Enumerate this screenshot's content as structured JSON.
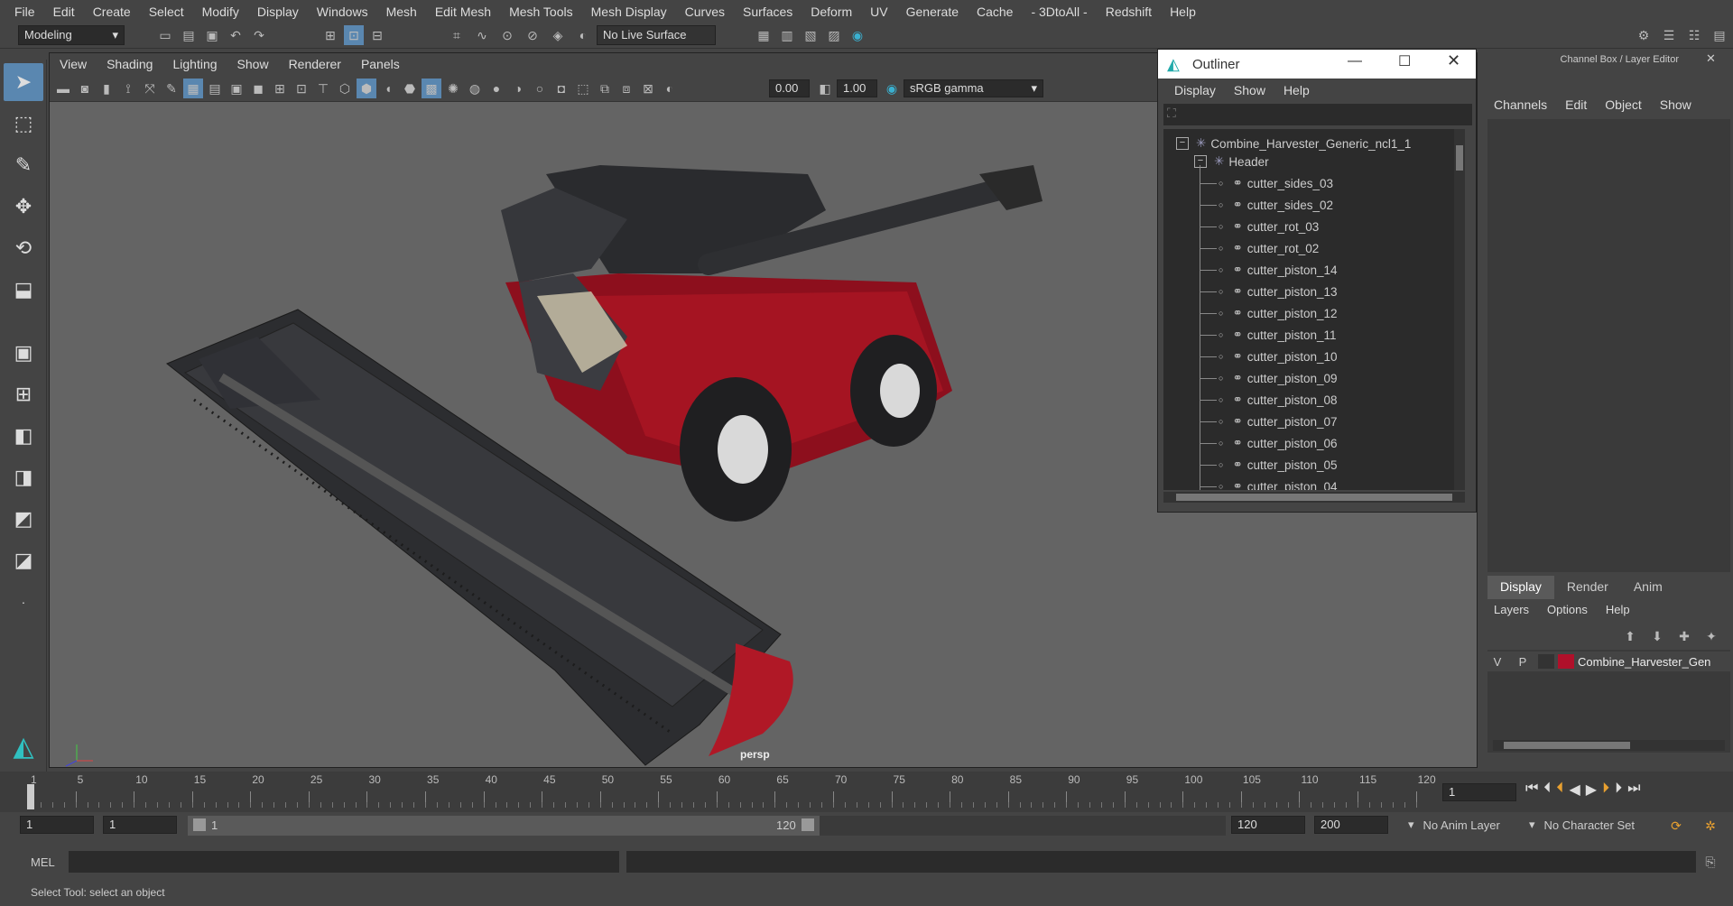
{
  "menubar": [
    "File",
    "Edit",
    "Create",
    "Select",
    "Modify",
    "Display",
    "Windows",
    "Mesh",
    "Edit Mesh",
    "Mesh Tools",
    "Mesh Display",
    "Curves",
    "Surfaces",
    "Deform",
    "UV",
    "Generate",
    "Cache",
    "- 3DtoAll -",
    "Redshift",
    "Help"
  ],
  "shelf": {
    "mode": "Modeling",
    "live_surface": "No Live Surface"
  },
  "viewport": {
    "menu": [
      "View",
      "Shading",
      "Lighting",
      "Show",
      "Renderer",
      "Panels"
    ],
    "exposure": "0.00",
    "gamma": "1.00",
    "color_space": "sRGB gamma",
    "camera_label": "persp"
  },
  "outliner": {
    "title": "Outliner",
    "menu": [
      "Display",
      "Show",
      "Help"
    ],
    "root": "Combine_Harvester_Generic_ncl1_1",
    "group": "Header",
    "items": [
      "cutter_sides_03",
      "cutter_sides_02",
      "cutter_rot_03",
      "cutter_rot_02",
      "cutter_piston_14",
      "cutter_piston_13",
      "cutter_piston_12",
      "cutter_piston_11",
      "cutter_piston_10",
      "cutter_piston_09",
      "cutter_piston_08",
      "cutter_piston_07",
      "cutter_piston_06",
      "cutter_piston_05",
      "cutter_piston_04"
    ]
  },
  "channel_box": {
    "title": "Channel Box / Layer Editor",
    "menu": [
      "Channels",
      "Edit",
      "Object",
      "Show"
    ],
    "tabs": [
      "Display",
      "Render",
      "Anim"
    ],
    "layer_menu": [
      "Layers",
      "Options",
      "Help"
    ],
    "layer": {
      "v": "V",
      "p": "P",
      "name": "Combine_Harvester_Gen",
      "color": "#b0102a"
    }
  },
  "timeline": {
    "ticks": [
      "1",
      "5",
      "10",
      "15",
      "20",
      "25",
      "30",
      "35",
      "40",
      "45",
      "50",
      "55",
      "60",
      "65",
      "70",
      "75",
      "80",
      "85",
      "90",
      "95",
      "100",
      "105",
      "110",
      "115",
      "120"
    ],
    "current": "1"
  },
  "range": {
    "start": "1",
    "inner_start": "1",
    "slider_start": "1",
    "slider_end": "120",
    "end": "120",
    "max": "200",
    "anim_layer": "No Anim Layer",
    "char_set": "No Character Set"
  },
  "mel": {
    "label": "MEL"
  },
  "status": {
    "text": "Select Tool: select an object"
  }
}
